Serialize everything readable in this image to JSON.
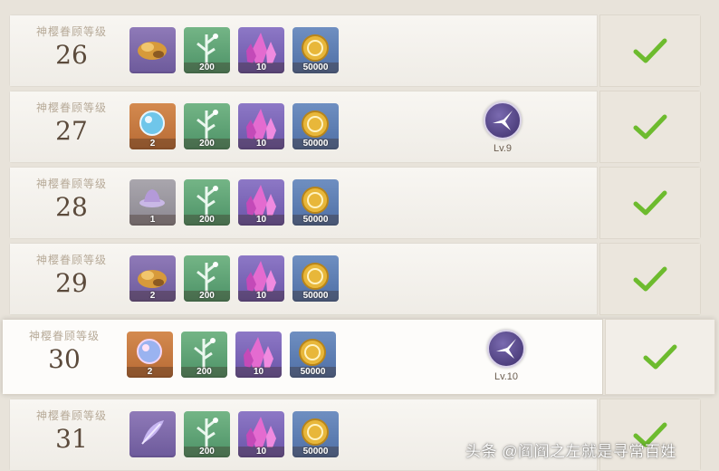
{
  "level_label": "神樱眷顾等级",
  "check_color": "#6dbb2e",
  "rows": [
    {
      "level": "26",
      "items": [
        {
          "icon": "ore-chunk-icon",
          "bg": "purple",
          "qty": ""
        },
        {
          "icon": "sacred-branch-icon",
          "bg": "green",
          "qty": "200"
        },
        {
          "icon": "crystal-cluster-icon",
          "bg": "violet",
          "qty": "10"
        },
        {
          "icon": "mora-coin-icon",
          "bg": "blue",
          "qty": "50000"
        }
      ],
      "unlock": null
    },
    {
      "level": "27",
      "items": [
        {
          "icon": "crystal-orb-icon",
          "bg": "orange",
          "qty": "2"
        },
        {
          "icon": "sacred-branch-icon",
          "bg": "green",
          "qty": "200"
        },
        {
          "icon": "crystal-cluster-icon",
          "bg": "violet",
          "qty": "10"
        },
        {
          "icon": "mora-coin-icon",
          "bg": "blue",
          "qty": "50000"
        }
      ],
      "unlock": {
        "label": "Lv.9",
        "icon": "gadget-badge-icon"
      }
    },
    {
      "level": "28",
      "items": [
        {
          "icon": "hat-icon",
          "bg": "gray",
          "qty": "1"
        },
        {
          "icon": "sacred-branch-icon",
          "bg": "green",
          "qty": "200"
        },
        {
          "icon": "crystal-cluster-icon",
          "bg": "violet",
          "qty": "10"
        },
        {
          "icon": "mora-coin-icon",
          "bg": "blue",
          "qty": "50000"
        }
      ],
      "unlock": null
    },
    {
      "level": "29",
      "items": [
        {
          "icon": "ore-chunk-icon",
          "bg": "purple",
          "qty": "2"
        },
        {
          "icon": "sacred-branch-icon",
          "bg": "green",
          "qty": "200"
        },
        {
          "icon": "crystal-cluster-icon",
          "bg": "violet",
          "qty": "10"
        },
        {
          "icon": "mora-coin-icon",
          "bg": "blue",
          "qty": "50000"
        }
      ],
      "unlock": null
    },
    {
      "level": "30",
      "items": [
        {
          "icon": "crystal-orb-icon",
          "bg": "orange",
          "qty": "2"
        },
        {
          "icon": "sacred-branch-icon",
          "bg": "green",
          "qty": "200"
        },
        {
          "icon": "crystal-cluster-icon",
          "bg": "violet",
          "qty": "10"
        },
        {
          "icon": "mora-coin-icon",
          "bg": "blue",
          "qty": "50000"
        }
      ],
      "unlock": {
        "label": "Lv.10",
        "icon": "gadget-badge-icon"
      }
    },
    {
      "level": "31",
      "items": [
        {
          "icon": "feather-icon",
          "bg": "purple",
          "qty": ""
        },
        {
          "icon": "sacred-branch-icon",
          "bg": "green",
          "qty": "200"
        },
        {
          "icon": "crystal-cluster-icon",
          "bg": "violet",
          "qty": "10"
        },
        {
          "icon": "mora-coin-icon",
          "bg": "blue",
          "qty": "50000"
        }
      ],
      "unlock": null
    }
  ],
  "watermark": "头条 @阎阎之左就是寻常百姓"
}
